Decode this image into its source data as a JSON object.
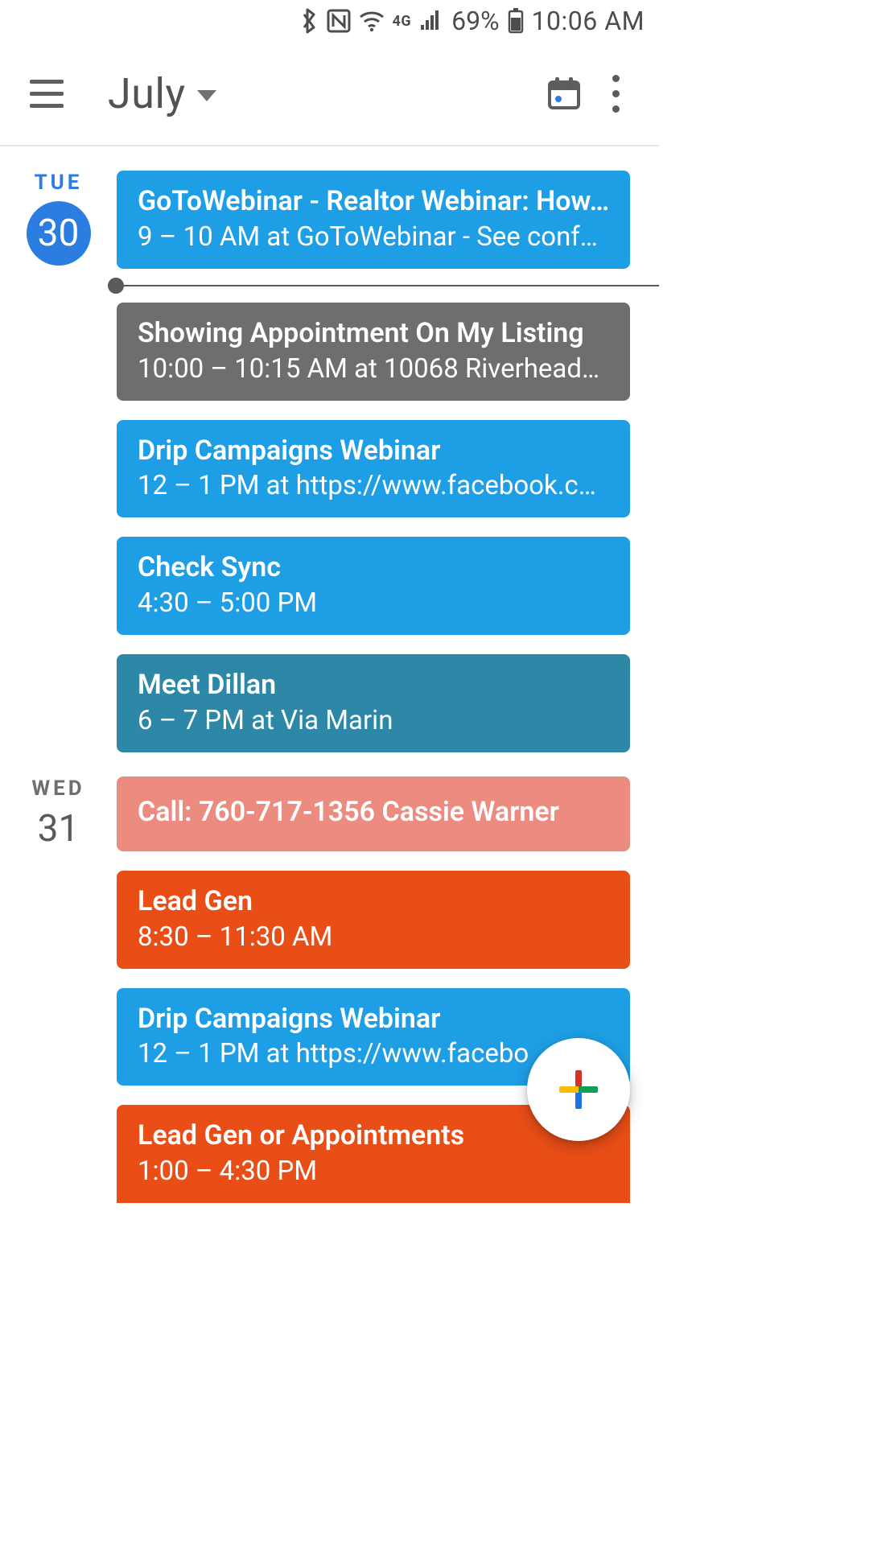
{
  "status": {
    "battery_percent": "69%",
    "time": "10:06 AM",
    "network_label": "4G"
  },
  "header": {
    "month": "July"
  },
  "colors": {
    "blue": "#1e9ee4",
    "gray": "#6e6e6e",
    "teal": "#2d87a6",
    "salmon": "#ec8b80",
    "orange": "#ea4e17"
  },
  "days": [
    {
      "dow": "TUE",
      "num": "30",
      "is_today": true,
      "has_now_indicator_after_index": 0,
      "events": [
        {
          "title": "GoToWebinar - Realtor Webinar: How…",
          "sub": "9 – 10 AM at GoToWebinar - See conf…",
          "color": "blue",
          "single": false
        },
        {
          "title": "Showing Appointment On My Listing",
          "sub": "10:00 – 10:15 AM at 10068 Riverhead…",
          "color": "gray",
          "single": false
        },
        {
          "title": "Drip Campaigns Webinar",
          "sub": "12 – 1 PM at https://www.facebook.c…",
          "color": "blue",
          "single": false
        },
        {
          "title": "Check Sync",
          "sub": "4:30 – 5:00 PM",
          "color": "blue",
          "single": false
        },
        {
          "title": "Meet Dillan",
          "sub": "6 – 7 PM at Via Marin",
          "color": "teal",
          "single": false
        }
      ]
    },
    {
      "dow": "WED",
      "num": "31",
      "is_today": false,
      "events": [
        {
          "title": "Call: 760-717-1356 Cassie Warner",
          "sub": "",
          "color": "salmon",
          "single": true
        },
        {
          "title": "Lead Gen",
          "sub": "8:30 – 11:30 AM",
          "color": "orange",
          "single": false
        },
        {
          "title": "Drip Campaigns Webinar",
          "sub": "12 – 1 PM at https://www.facebo",
          "color": "blue",
          "single": false
        },
        {
          "title": "Lead Gen or Appointments",
          "sub": "1:00 – 4:30 PM",
          "color": "orange",
          "single": false,
          "cut": true
        }
      ]
    }
  ]
}
